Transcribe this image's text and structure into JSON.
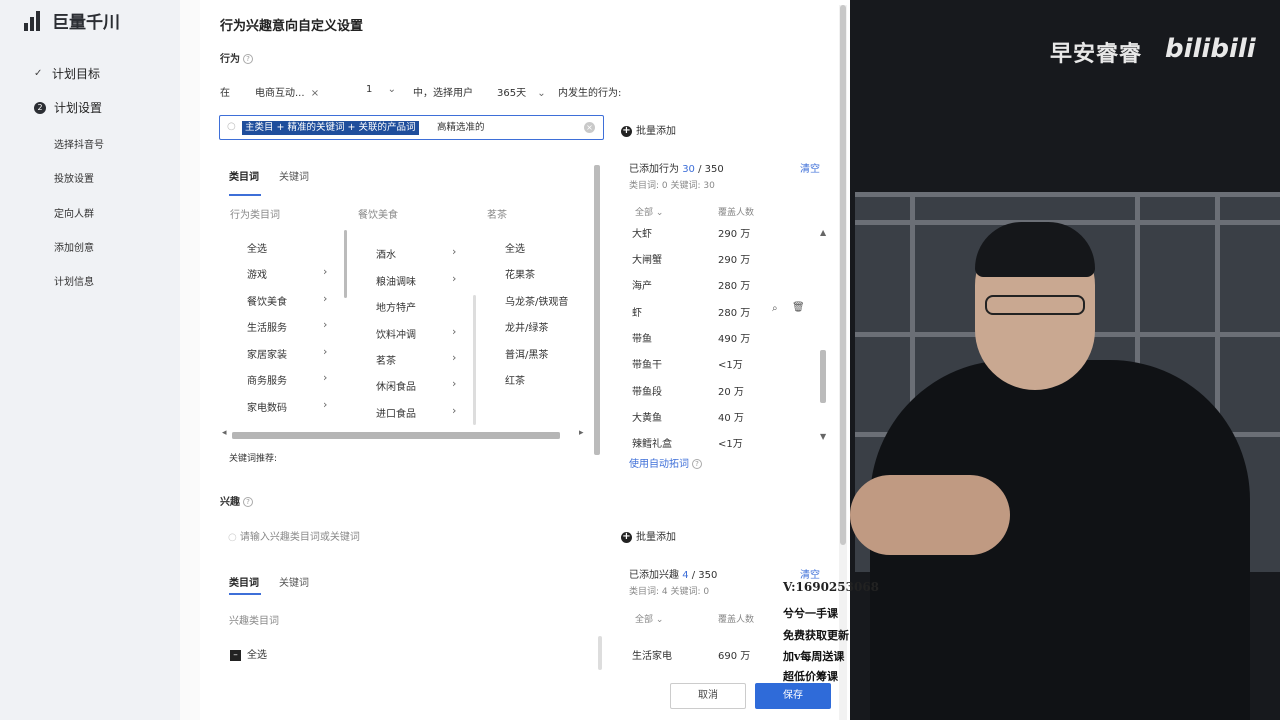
{
  "app": {
    "logo_text": "巨量千川",
    "nav": [
      {
        "label": "计划目标",
        "kind": "main"
      },
      {
        "label": "计划设置",
        "kind": "main"
      },
      {
        "label": "选择抖音号",
        "kind": "sub"
      },
      {
        "label": "投放设置",
        "kind": "sub"
      },
      {
        "label": "定向人群",
        "kind": "sub"
      },
      {
        "label": "添加创意",
        "kind": "sub"
      },
      {
        "label": "计划信息",
        "kind": "sub"
      }
    ]
  },
  "modal": {
    "title": "行为兴趣意向自定义设置",
    "behavior_label": "行为",
    "condition": {
      "prefix": "在",
      "scene": "电商互动...",
      "count": "1",
      "middle": "中，选择用户",
      "days": "365天",
      "suffix": "内发生的行为:"
    },
    "search": {
      "highlighted": "主类目 + 精准的关键词 + 关联的产品词",
      "rest": "高精选准的"
    },
    "batch_add": "批量添加",
    "tabs": {
      "category": "类目词",
      "keyword": "关键词"
    },
    "columns": {
      "col1_header": "行为类目词",
      "col2_header": "餐饮美食",
      "col3_header": "茗茶"
    },
    "col1": [
      "全选",
      "游戏",
      "餐饮美食",
      "生活服务",
      "家居家装",
      "商务服务",
      "家电数码"
    ],
    "col2": [
      "酒水",
      "粮油调味",
      "地方特产",
      "饮料冲调",
      "茗茶",
      "休闲食品",
      "进口食品"
    ],
    "col3": [
      "全选",
      "花果茶",
      "乌龙茶/铁观音",
      "龙井/绿茶",
      "普洱/黑茶",
      "红茶"
    ],
    "keyword_hint": "关键词推荐:",
    "added": {
      "title": "已添加行为",
      "count": "30",
      "max": "350",
      "clear": "清空",
      "sub": "类目词: 0    关键词: 30",
      "col_all": "全部",
      "col_cover": "覆盖人数",
      "rows": [
        {
          "word": "大虾",
          "cover": "290 万"
        },
        {
          "word": "大闸蟹",
          "cover": "290 万"
        },
        {
          "word": "海产",
          "cover": "280 万"
        },
        {
          "word": "虾",
          "cover": "280 万"
        },
        {
          "word": "带鱼",
          "cover": "490 万"
        },
        {
          "word": "带鱼干",
          "cover": "<1万"
        },
        {
          "word": "带鱼段",
          "cover": "20 万"
        },
        {
          "word": "大黄鱼",
          "cover": "40 万"
        },
        {
          "word": "辣鳕礼盒",
          "cover": "<1万"
        }
      ],
      "auto_words": "使用自动拓词"
    },
    "interest_label": "兴趣",
    "interest_placeholder": "请输入兴趣类目词或关键词",
    "interest_col_header": "兴趣类目词",
    "interest_select_all": "全选",
    "interest_added": {
      "title": "已添加兴趣",
      "count": "4",
      "max": "350",
      "clear": "清空",
      "sub": "类目词: 4    关键词: 0",
      "col_all": "全部",
      "col_cover": "覆盖人数",
      "rows": [
        {
          "word": "生活家电",
          "cover": "690 万"
        }
      ]
    },
    "cancel": "取消",
    "save": "保存"
  },
  "video": {
    "uploader": "早安睿睿",
    "brand": "bilibili",
    "contact": "V:1690253068",
    "promo_lines": [
      "兮兮一手课",
      "免费获取更新",
      "加v每周送课",
      "超低价筹课"
    ]
  }
}
